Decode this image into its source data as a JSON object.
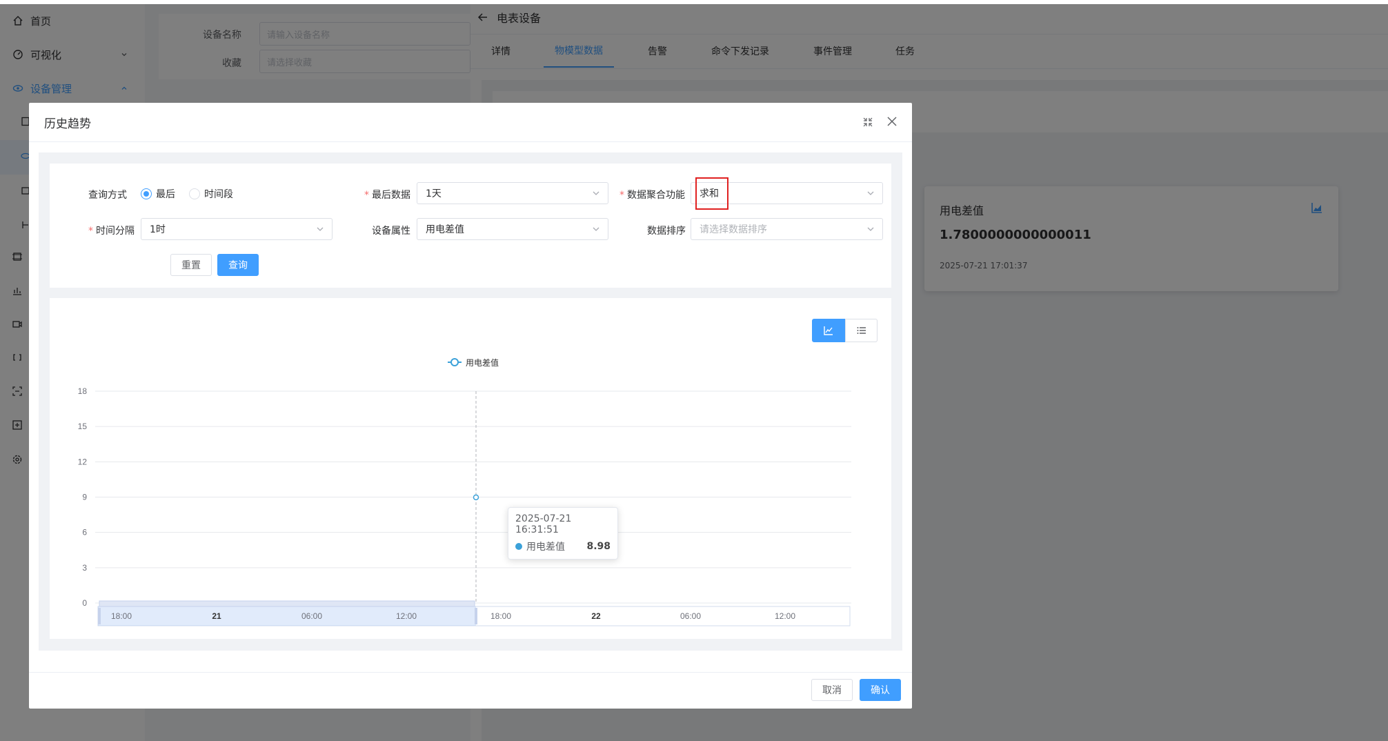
{
  "sidebar": {
    "items": [
      {
        "label": "首页",
        "icon": "home-icon"
      },
      {
        "label": "可视化",
        "icon": "dashboard-icon"
      },
      {
        "label": "设备管理",
        "icon": "device-icon"
      }
    ]
  },
  "background": {
    "form": {
      "device_name_label": "设备名称",
      "device_name_placeholder": "请输入设备名称",
      "favorite_label": "收藏",
      "favorite_placeholder": "请选择收藏"
    }
  },
  "drawer": {
    "title": "电表设备",
    "tabs": [
      "详情",
      "物模型数据",
      "告警",
      "命令下发记录",
      "事件管理",
      "任务"
    ],
    "active_tab": 1,
    "card": {
      "title": "用电差值",
      "value": "1.7800000000000011",
      "timestamp": "2025-07-21 17:01:37"
    }
  },
  "modal": {
    "title": "历史趋势",
    "form": {
      "query_mode_label": "查询方式",
      "query_mode_options": [
        "最后",
        "时间段"
      ],
      "query_mode_selected": "最后",
      "last_data_label": "最后数据",
      "last_data_value": "1天",
      "aggregate_label": "数据聚合功能",
      "aggregate_value": "求和",
      "interval_label": "时间分隔",
      "interval_value": "1时",
      "property_label": "设备属性",
      "property_value": "用电差值",
      "sort_label": "数据排序",
      "sort_placeholder": "请选择数据排序",
      "reset_label": "重置",
      "query_label": "查询"
    },
    "footer": {
      "cancel_label": "取消",
      "confirm_label": "确认"
    }
  },
  "chart_data": {
    "type": "line",
    "title": "",
    "xlabel": "",
    "ylabel": "",
    "legend": [
      "用电差值"
    ],
    "legend_position": "top-center",
    "ylim": [
      0,
      18
    ],
    "y_ticks": [
      0,
      3,
      6,
      9,
      12,
      15,
      18
    ],
    "series": [
      {
        "name": "用电差值",
        "color": "#3ba1d9",
        "points": [
          {
            "x": "2025-07-21 16:31:51",
            "y": 8.98
          }
        ]
      }
    ],
    "x_axis_range": [
      "2025-07-20 16:31:51",
      "2025-07-21 16:31:51"
    ],
    "slider_labels": [
      "18:00",
      "21",
      "06:00",
      "12:00",
      "18:00",
      "22",
      "06:00",
      "12:00"
    ],
    "tooltip": {
      "time": "2025-07-21 16:31:51",
      "series": "用电差值",
      "value": "8.98"
    },
    "grid": true
  },
  "colors": {
    "primary": "#409eff",
    "series": "#3ba1d9",
    "highlight_box": "#e02020"
  }
}
